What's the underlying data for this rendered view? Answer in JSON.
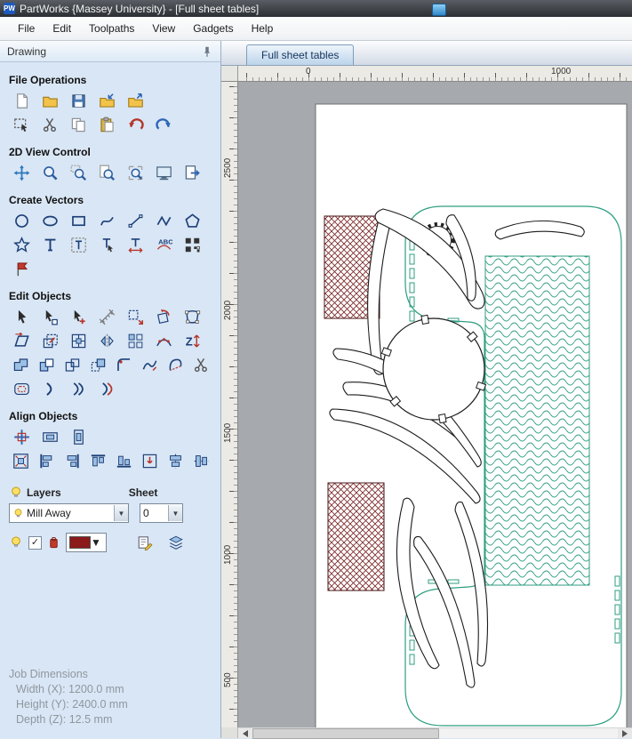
{
  "window": {
    "app_icon_text": "PW",
    "title": "PartWorks {Massey University} - [Full sheet tables]"
  },
  "menu": {
    "items": [
      "File",
      "Edit",
      "Toolpaths",
      "View",
      "Gadgets",
      "Help"
    ]
  },
  "panel": {
    "title": "Drawing",
    "sections": {
      "file_operations": {
        "label": "File Operations"
      },
      "view_control": {
        "label": "2D View Control"
      },
      "create_vectors": {
        "label": "Create Vectors"
      },
      "edit_objects": {
        "label": "Edit Objects"
      },
      "align_objects": {
        "label": "Align Objects"
      }
    },
    "toolbars": {
      "file_operations": {
        "rows": [
          [
            "new-file",
            "open-file",
            "save-file",
            "import-vectors",
            "export-vectors"
          ],
          [
            "select-marquee",
            "cut",
            "copy",
            "paste",
            "undo",
            "redo"
          ]
        ]
      },
      "view_control": {
        "rows": [
          [
            "pan-view",
            "zoom-interactive",
            "zoom-box",
            "zoom-drawing",
            "zoom-selected",
            "zoom-sheet",
            "switch-view"
          ]
        ]
      },
      "create_vectors": {
        "rows": [
          [
            "draw-circle",
            "draw-ellipse",
            "draw-rectangle",
            "draw-polyline",
            "draw-line",
            "draw-curve",
            "draw-polygon"
          ],
          [
            "draw-star",
            "draw-text",
            "text-box",
            "text-select",
            "text-kerning",
            "text-on-curve",
            "draw-datamatrix"
          ],
          [
            "dimension-flag"
          ]
        ]
      },
      "edit_objects": {
        "rows": [
          [
            "select-tool",
            "node-edit",
            "quick-select",
            "measure-tool",
            "move-selection",
            "rotate-selection",
            "distort-object"
          ],
          [
            "shear-object",
            "scale-object",
            "center-in-sheet",
            "mirror-object",
            "array-copy",
            "paste-along-curve",
            "z-move"
          ],
          [
            "weld-vectors",
            "subtract-vectors",
            "trim-vectors",
            "keep-overlap",
            "fillet-tool",
            "curve-fit",
            "join-vectors",
            "snip-vectors"
          ],
          [
            "offset-vectors",
            "flip-horizontal",
            "flip-vertical",
            "flip-diagonal"
          ]
        ]
      },
      "align_objects": {
        "rows": [
          [
            "align-center",
            "align-middle-h",
            "align-middle-v"
          ],
          [
            "align-to-sheet",
            "align-left",
            "align-right",
            "align-top",
            "align-bottom",
            "align-stack",
            "align-center-h",
            "align-center-v"
          ]
        ]
      }
    },
    "layers": {
      "label": "Layers",
      "sheet_label": "Sheet",
      "layer_value": "Mill Away",
      "sheet_value": "0"
    },
    "job_dimensions": {
      "title": "Job Dimensions",
      "width": "Width  (X): 1200.0 mm",
      "height": "Height (Y): 2400.0 mm",
      "depth": "Depth  (Z): 12.5 mm"
    }
  },
  "main": {
    "tab": "Full sheet tables",
    "ruler_h": [
      "0",
      "1000"
    ],
    "ruler_v": [
      "2500",
      "2000",
      "1500",
      "1000",
      "500"
    ]
  }
}
